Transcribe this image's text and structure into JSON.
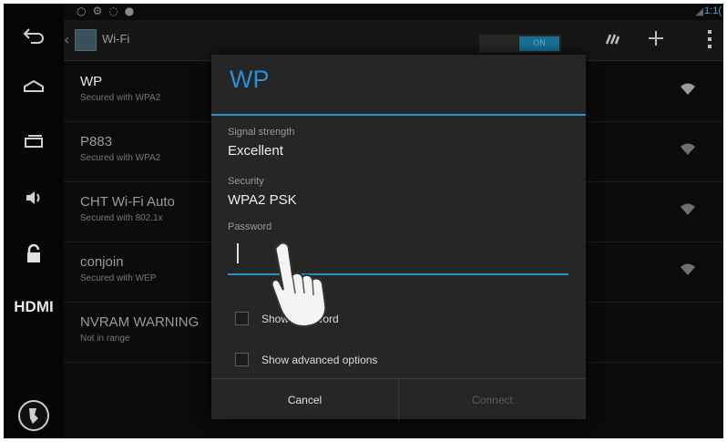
{
  "statusbar": {
    "clock": "1:1("
  },
  "actionbar": {
    "title": "Wi-Fi",
    "toggle_label": "ON"
  },
  "networks": [
    {
      "name": "WP",
      "security": "Secured with WPA2"
    },
    {
      "name": "P883",
      "security": "Secured with WPA2"
    },
    {
      "name": "CHT Wi-Fi Auto",
      "security": "Secured with 802.1x"
    },
    {
      "name": "conjoin",
      "security": "Secured with WEP"
    },
    {
      "name": "NVRAM WARNING",
      "security": "Not in range"
    }
  ],
  "nav": {
    "hdmi_label": "HDMI"
  },
  "dialog": {
    "title": "WP",
    "signal_label": "Signal strength",
    "signal_value": "Excellent",
    "security_label": "Security",
    "security_value": "WPA2 PSK",
    "password_label": "Password",
    "password_value": "",
    "show_password_label": "Show password",
    "show_password_checked": false,
    "advanced_label": "Show advanced options",
    "advanced_checked": false,
    "cancel_label": "Cancel",
    "connect_label": "Connect"
  },
  "colors": {
    "accent": "#2b8fd8",
    "background": "#0b0b0b",
    "dialog": "#262626"
  },
  "icons": [
    "back-icon",
    "home-icon",
    "recent-apps-icon",
    "volume-icon",
    "unlock-icon",
    "power-button-icon",
    "wifi-signal-icon",
    "wps-icon",
    "add-network-icon",
    "overflow-menu-icon"
  ]
}
